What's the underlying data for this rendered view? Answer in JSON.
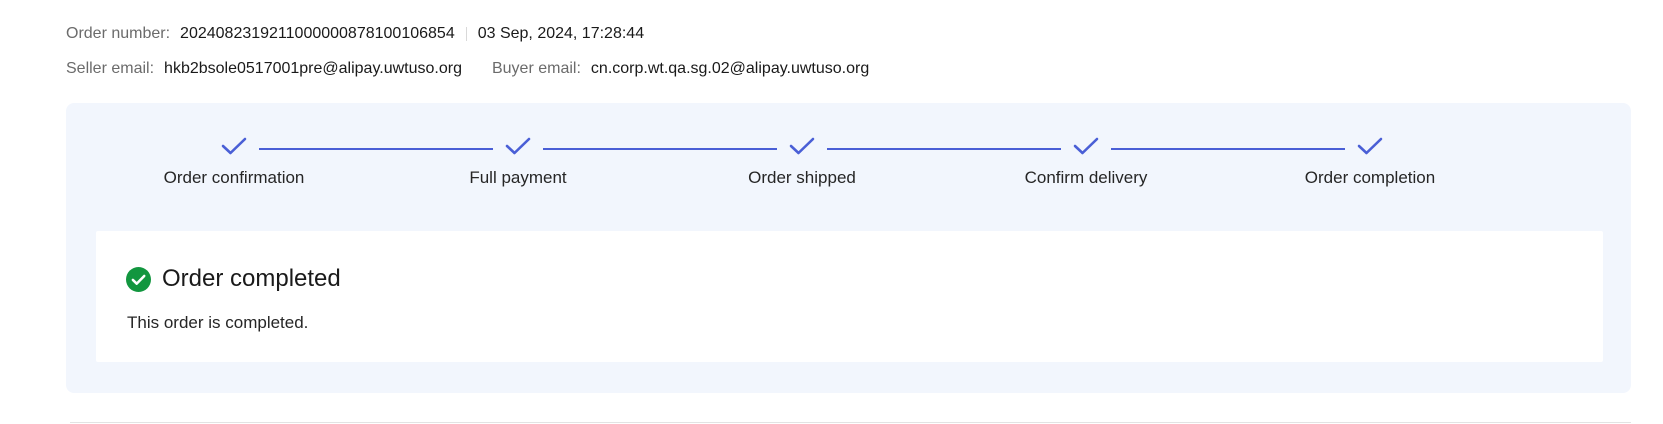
{
  "order_info": {
    "order_number_label": "Order number",
    "colon": ":",
    "order_number": "20240823192110000008781001068 54",
    "order_datetime": "03 Sep, 2024, 17:28:44",
    "seller_email_label": "Seller email",
    "seller_email": "hkb2bsole0517001pre@alipay.uwtuso.org",
    "buyer_email_label": "Buyer email",
    "buyer_email": "cn.corp.wt.qa.sg.02@alipay.uwtuso.org"
  },
  "progress": {
    "accent_color": "#4a5fd6",
    "steps": [
      {
        "label": "Order confirmation",
        "icon": "check-icon",
        "completed": true
      },
      {
        "label": "Full payment",
        "icon": "check-icon",
        "completed": true
      },
      {
        "label": "Order shipped",
        "icon": "check-icon",
        "completed": true
      },
      {
        "label": "Confirm delivery",
        "icon": "check-icon",
        "completed": true
      },
      {
        "label": "Order completion",
        "icon": "check-icon",
        "completed": true
      }
    ]
  },
  "status": {
    "icon": "check-circle-icon",
    "icon_color": "#12963f",
    "title": "Order completed",
    "description": "This order is completed."
  }
}
